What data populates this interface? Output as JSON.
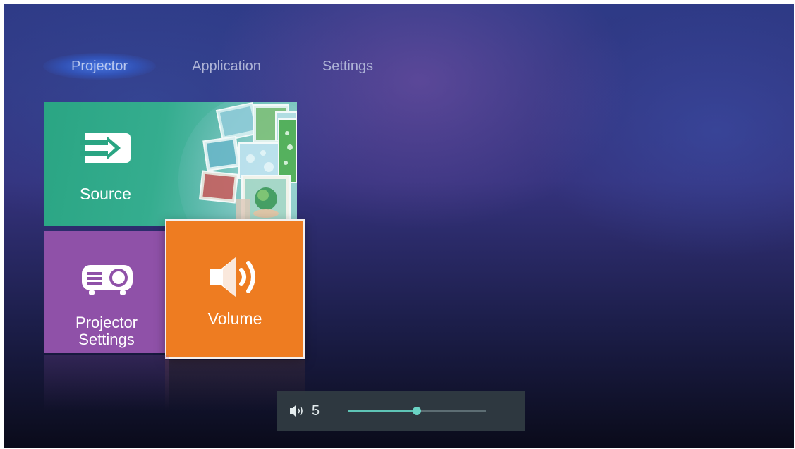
{
  "tabs": [
    {
      "label": "Projector",
      "active": true
    },
    {
      "label": "Application",
      "active": false
    },
    {
      "label": "Settings",
      "active": false
    }
  ],
  "tiles": {
    "source": {
      "label": "Source",
      "icon": "input-arrow-icon",
      "color": "#2aa583"
    },
    "projector_settings": {
      "line1": "Projector",
      "line2": "Settings",
      "icon": "projector-icon",
      "color": "#8f51a8"
    },
    "volume": {
      "label": "Volume",
      "icon": "speaker-icon",
      "color": "#ee7c21",
      "focused": true
    }
  },
  "volume_osd": {
    "icon": "speaker-small-icon",
    "value": "5",
    "level_fraction": 0.5,
    "accent_color": "#5ec4b6"
  }
}
